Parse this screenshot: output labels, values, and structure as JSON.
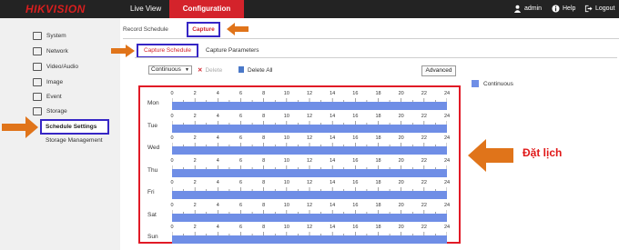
{
  "header": {
    "logo": "HIKVISION",
    "nav": [
      "Live View",
      "Configuration"
    ],
    "user": "admin",
    "help": "Help",
    "logout": "Logout"
  },
  "sidebar": {
    "items": [
      {
        "label": "System",
        "icon": "monitor-icon"
      },
      {
        "label": "Network",
        "icon": "network-icon"
      },
      {
        "label": "Video/Audio",
        "icon": "video-icon"
      },
      {
        "label": "Image",
        "icon": "image-icon"
      },
      {
        "label": "Event",
        "icon": "event-icon"
      },
      {
        "label": "Storage",
        "icon": "storage-icon"
      }
    ],
    "selected": "Schedule Settings",
    "sub": "Storage Management"
  },
  "tabs": {
    "top": [
      "Record Schedule",
      "Capture"
    ],
    "sub": [
      "Capture Schedule",
      "Capture Parameters"
    ]
  },
  "toolbar": {
    "mode": "Continuous",
    "delete": "Delete",
    "delete_all": "Delete All",
    "advanced": "Advanced"
  },
  "legend": {
    "label": "Continuous",
    "color": "#6f8ee6"
  },
  "schedule": {
    "ticks": [
      "0",
      "2",
      "4",
      "6",
      "8",
      "10",
      "12",
      "14",
      "16",
      "18",
      "20",
      "22",
      "24"
    ],
    "days": [
      "Mon",
      "Tue",
      "Wed",
      "Thu",
      "Fri",
      "Sat",
      "Sun"
    ]
  },
  "annotation": {
    "text": "Đặt lịch",
    "color": "#e01818"
  },
  "colors": {
    "accent": "#d4232b",
    "highlight": "#3626c5",
    "arrow": "#e0741a",
    "bar": "#6f8ee6"
  }
}
